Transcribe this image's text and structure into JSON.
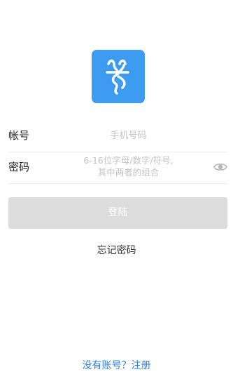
{
  "logo": {
    "icon": "app-logo-glyph",
    "color": "#3d9bf0"
  },
  "form": {
    "account_label": "帐号",
    "account_placeholder": "手机号码",
    "password_label": "密码",
    "password_placeholder_line1": "6-16位字母/数字/符号,",
    "password_placeholder_line2": "其中两者的组合",
    "eye_icon": "eye-icon"
  },
  "login_button": "登陆",
  "forgot_password": "忘记密码",
  "register_link": "没有账号？注册",
  "colors": {
    "accent": "#2f7de0",
    "button_disabled": "#dcdcdc"
  }
}
